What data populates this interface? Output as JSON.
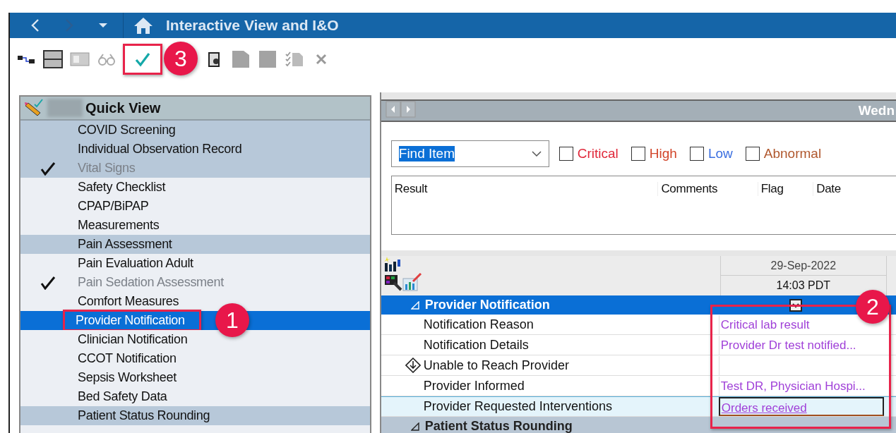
{
  "window": {
    "title": "Interactive View and I&O"
  },
  "toolbar": {
    "check_callout": "3"
  },
  "quick_view": {
    "title": "Quick View",
    "items": [
      {
        "label": "COVID Screening",
        "kind": "band",
        "checked": false,
        "selected": false
      },
      {
        "label": "Individual Observation Record",
        "kind": "band",
        "checked": false,
        "selected": false
      },
      {
        "label": "Vital Signs",
        "kind": "band",
        "checked": true,
        "selected": false
      },
      {
        "label": "Safety Checklist",
        "kind": "item",
        "checked": false,
        "selected": false
      },
      {
        "label": "CPAP/BiPAP",
        "kind": "item",
        "checked": false,
        "selected": false
      },
      {
        "label": "Measurements",
        "kind": "item",
        "checked": false,
        "selected": false
      },
      {
        "label": "Pain Assessment",
        "kind": "band",
        "checked": false,
        "selected": false
      },
      {
        "label": "Pain Evaluation Adult",
        "kind": "item",
        "checked": false,
        "selected": false
      },
      {
        "label": "Pain Sedation Assessment",
        "kind": "item",
        "checked": true,
        "selected": false
      },
      {
        "label": "Comfort Measures",
        "kind": "item",
        "checked": false,
        "selected": false
      },
      {
        "label": "Provider Notification",
        "kind": "item",
        "checked": false,
        "selected": true,
        "callout": "1"
      },
      {
        "label": "Clinician Notification",
        "kind": "item",
        "checked": false,
        "selected": false
      },
      {
        "label": "CCOT Notification",
        "kind": "item",
        "checked": false,
        "selected": false
      },
      {
        "label": "Sepsis Worksheet",
        "kind": "item",
        "checked": false,
        "selected": false
      },
      {
        "label": "Bed Safety Data",
        "kind": "item",
        "checked": false,
        "selected": false
      },
      {
        "label": "Patient Status Rounding",
        "kind": "band",
        "checked": false,
        "selected": false
      }
    ]
  },
  "date_bar": {
    "label": "Wedn"
  },
  "filter": {
    "find": "Find Item",
    "flags": [
      {
        "label": "Critical",
        "checked": false,
        "color": "#e0283a"
      },
      {
        "label": "High",
        "checked": false,
        "color": "#d2452a"
      },
      {
        "label": "Low",
        "checked": false,
        "color": "#3b6fe0"
      },
      {
        "label": "Abnormal",
        "checked": false,
        "color": "#b0582e"
      }
    ]
  },
  "results_table": {
    "columns": [
      "Result",
      "Comments",
      "Flag",
      "Date"
    ]
  },
  "flowsheet": {
    "date": "29-Sep-2022",
    "time": "14:03 PDT",
    "callout": "2",
    "sections": [
      {
        "label": "Provider Notification",
        "selected": true,
        "expanded": true,
        "rows": [
          {
            "label": "Notification Reason",
            "value": "Critical lab result",
            "kind": "plain",
            "selected": false
          },
          {
            "label": "Notification Details",
            "value": "Provider Dr test notified...",
            "kind": "plain",
            "selected": false
          },
          {
            "label": "Unable to Reach Provider",
            "kind": "conditional",
            "selected": false
          },
          {
            "label": "Provider Informed",
            "value": "Test DR, Physician Hospi...",
            "kind": "plain",
            "selected": false
          },
          {
            "label": "Provider Requested Interventions",
            "value": "Orders received",
            "kind": "plain",
            "selected": true
          }
        ]
      },
      {
        "label": "Patient Status Rounding",
        "selected": false,
        "expanded": true
      }
    ]
  }
}
